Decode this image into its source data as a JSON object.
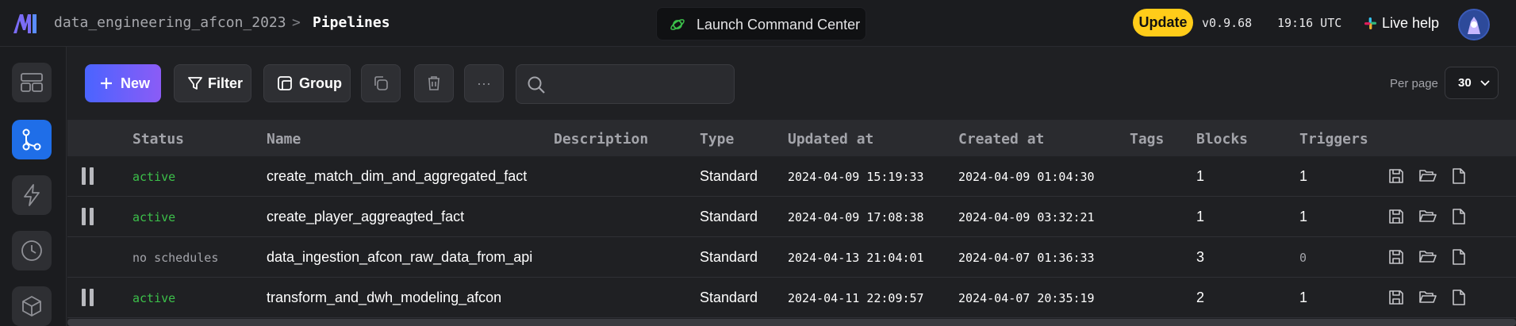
{
  "header": {
    "project": "data_engineering_afcon_2023",
    "separator": ">",
    "page": "Pipelines",
    "launch_label": "Launch Command Center",
    "update_label": "Update",
    "version": "v0.9.68",
    "time": "19:16 UTC",
    "live_help": "Live help"
  },
  "toolbar": {
    "new_label": "New",
    "filter_label": "Filter",
    "group_label": "Group",
    "more_label": "···",
    "search_placeholder": "",
    "per_page_label": "Per page",
    "per_page_value": "30"
  },
  "table": {
    "columns": [
      "Status",
      "Name",
      "Description",
      "Type",
      "Updated at",
      "Created at",
      "Tags",
      "Blocks",
      "Triggers"
    ],
    "rows": [
      {
        "status": "active",
        "name": "create_match_dim_and_aggregated_fact",
        "description": "",
        "type": "Standard",
        "updated": "2024-04-09 15:19:33",
        "created": "2024-04-09 01:04:30",
        "tags": "",
        "blocks": "1",
        "triggers": "1"
      },
      {
        "status": "active",
        "name": "create_player_aggreagted_fact",
        "description": "",
        "type": "Standard",
        "updated": "2024-04-09 17:08:38",
        "created": "2024-04-09 03:32:21",
        "tags": "",
        "blocks": "1",
        "triggers": "1"
      },
      {
        "status": "no schedules",
        "name": "data_ingestion_afcon_raw_data_from_api",
        "description": "",
        "type": "Standard",
        "updated": "2024-04-13 21:04:01",
        "created": "2024-04-07 01:36:33",
        "tags": "",
        "blocks": "3",
        "triggers": "0"
      },
      {
        "status": "active",
        "name": "transform_and_dwh_modeling_afcon",
        "description": "",
        "type": "Standard",
        "updated": "2024-04-11 22:09:57",
        "created": "2024-04-07 20:35:19",
        "tags": "",
        "blocks": "2",
        "triggers": "1"
      }
    ]
  },
  "colors": {
    "accent": "#1f6ee8",
    "active_status": "#3cc04a",
    "update": "#ffcc19"
  }
}
